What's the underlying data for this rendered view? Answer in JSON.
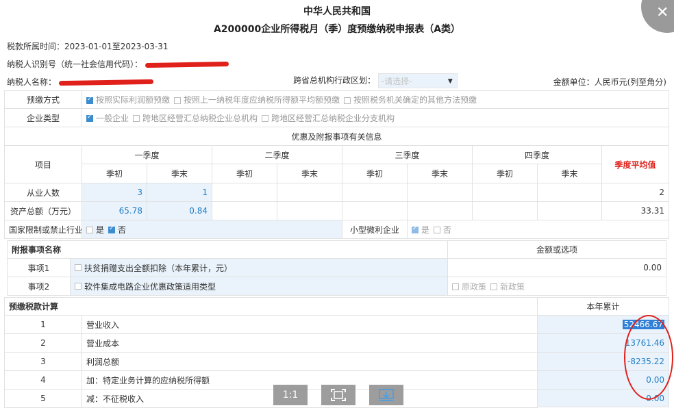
{
  "titles": {
    "line1": "中华人民共和国",
    "line2": "A200000企业所得税月（季）度预缴纳税申报表（A类）"
  },
  "header": {
    "period_label": "税款所属时间：",
    "period_value": "2023-01-01至2023-03-31",
    "taxpayer_id_label": "纳税人识别号（统一社会信用代码）：",
    "taxpayer_name_label": "纳税人名称：",
    "region_label": "跨省总机构行政区划：",
    "region_placeholder": "-请选择-",
    "unit_text": "金额单位：人民币元(列至角分)"
  },
  "prepay_method": {
    "label": "预缴方式",
    "options": [
      "按照实际利润额预缴",
      "按照上一纳税年度应纳税所得额平均额预缴",
      "按照税务机关确定的其他方法预缴"
    ]
  },
  "enterprise_type": {
    "label": "企业类型",
    "options": [
      "一般企业",
      "跨地区经营汇总纳税企业总机构",
      "跨地区经营汇总纳税企业分支机构"
    ]
  },
  "preferential": {
    "section_title": "优惠及附报事项有关信息",
    "item_header": "项目",
    "quarters": [
      "一季度",
      "二季度",
      "三季度",
      "四季度"
    ],
    "q_start": "季初",
    "q_end": "季末",
    "avg_header": "季度平均值",
    "rows": [
      {
        "label": "从业人数",
        "q1_start": "3",
        "q1_end": "1",
        "avg": "2"
      },
      {
        "label": "资产总额（万元）",
        "q1_start": "65.78",
        "q1_end": "0.84",
        "avg": "33.31"
      }
    ],
    "restricted_label": "国家限制或禁止行业",
    "yes": "是",
    "no": "否",
    "small_label": "小型微利企业"
  },
  "attached": {
    "header": "附报事项名称",
    "value_header": "金额或选项",
    "items": [
      {
        "label": "事项1",
        "name": "扶贫捐赠支出全额扣除（本年累计，元）",
        "value": "0.00"
      },
      {
        "label": "事项2",
        "name": "软件集成电路企业优惠政策适用类型",
        "opt1": "原政策",
        "opt2": "新政策"
      }
    ]
  },
  "calc": {
    "header": "预缴税款计算",
    "col_header": "本年累计",
    "rows": [
      {
        "no": "1",
        "name": "营业收入",
        "value": "52466.67"
      },
      {
        "no": "2",
        "name": "营业成本",
        "value": "13761.46"
      },
      {
        "no": "3",
        "name": "利润总额",
        "value": "-8235.22"
      },
      {
        "no": "4",
        "name": "加：特定业务计算的应纳税所得额",
        "value": "0.00"
      },
      {
        "no": "5",
        "name": "减：不征税收入",
        "value": "0.00"
      }
    ]
  },
  "toolbar": {
    "actual_size": "1:1"
  },
  "icons": [
    "close-icon",
    "fullscreen-icon",
    "download-icon",
    "caret-down-icon"
  ]
}
